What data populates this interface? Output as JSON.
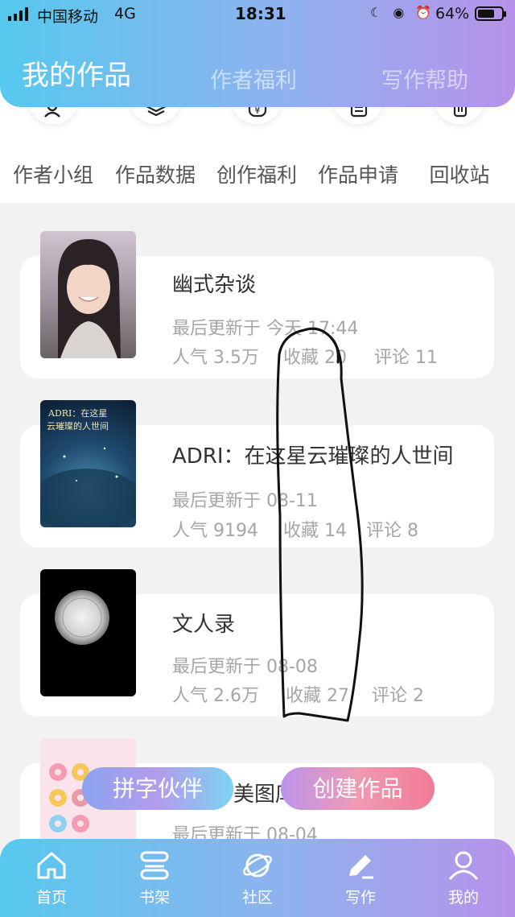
{
  "status_bar": {
    "carrier": "中国移动",
    "network": "4G",
    "time": "18:31",
    "battery": "64%"
  },
  "header": {
    "tabs": [
      {
        "label": "我的作品",
        "active": true
      },
      {
        "label": "作者福利",
        "active": false
      },
      {
        "label": "写作帮助",
        "active": false
      }
    ]
  },
  "quick_actions": [
    {
      "label": "作者小组",
      "icon": "group-icon"
    },
    {
      "label": "作品数据",
      "icon": "layers-icon"
    },
    {
      "label": "创作福利",
      "icon": "yen-badge-icon"
    },
    {
      "label": "作品申请",
      "icon": "document-icon"
    },
    {
      "label": "回收站",
      "icon": "trash-icon"
    }
  ],
  "works": [
    {
      "title": "幽式杂谈",
      "updated": "最后更新于 今天 17:44",
      "popularity": "人气 3.5万",
      "favorites": "收藏 20",
      "comments": "评论 11",
      "cover_text": ""
    },
    {
      "title": "ADRI：在这星云璀璨的人世间",
      "updated": "最后更新于 08-11",
      "popularity": "人气 9194",
      "favorites": "收藏 14",
      "comments": "评论 8",
      "cover_text": "ADRI：在这星云璀璨的人世间"
    },
    {
      "title": "文人录",
      "updated": "最后更新于 08-08",
      "popularity": "人气 2.6万",
      "favorites": "收藏 27",
      "comments": "评论 2",
      "cover_text": ""
    },
    {
      "title": "美图库",
      "updated": "最后更新于 08-04",
      "popularity": "",
      "favorites": "",
      "comments": "",
      "cover_text": ""
    }
  ],
  "floating_buttons": {
    "partner": "拼字伙伴",
    "create": "创建作品"
  },
  "bottom_nav": [
    {
      "label": "首页",
      "icon": "home-icon"
    },
    {
      "label": "书架",
      "icon": "bookshelf-icon"
    },
    {
      "label": "社区",
      "icon": "planet-icon"
    },
    {
      "label": "写作",
      "icon": "pen-icon",
      "active": true
    },
    {
      "label": "我的",
      "icon": "person-icon"
    }
  ],
  "colors": {
    "gradient_start": "#56c9ee",
    "gradient_end": "#b792ea",
    "create_button": "#f27a96"
  }
}
